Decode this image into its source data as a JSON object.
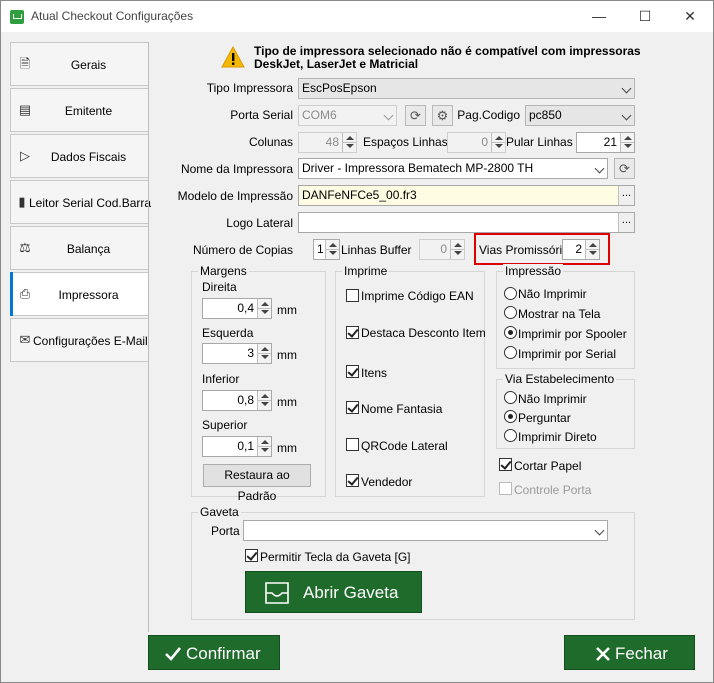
{
  "window": {
    "title": "Atual Checkout Configurações"
  },
  "sidebar": {
    "items": [
      {
        "label": "Gerais",
        "icon": "document-icon"
      },
      {
        "label": "Emitente",
        "icon": "card-icon"
      },
      {
        "label": "Dados Fiscais",
        "icon": "flag-icon"
      },
      {
        "label": "Leitor Serial Cod.Barra",
        "icon": "barcode-icon"
      },
      {
        "label": "Balança",
        "icon": "scale-icon"
      },
      {
        "label": "Impressora",
        "icon": "printer-icon"
      },
      {
        "label": "Configurações E-Mail",
        "icon": "email-icon"
      }
    ],
    "active_index": 5
  },
  "warning": {
    "line1": "Tipo de impressora selecionado não é compatível com impressoras",
    "line2": "DeskJet, LaserJet e Matricial"
  },
  "form": {
    "tipo_impressora_label": "Tipo Impressora",
    "tipo_impressora_value": "EscPosEpson",
    "porta_serial_label": "Porta Serial",
    "porta_serial_value": "COM6",
    "pag_codigo_label": "Pag.Codigo",
    "pag_codigo_value": "pc850",
    "colunas_label": "Colunas",
    "colunas_value": "48",
    "espacos_linhas_label": "Espaços Linhas",
    "espacos_linhas_value": "0",
    "pular_linhas_label": "Pular Linhas",
    "pular_linhas_value": "21",
    "nome_impressora_label": "Nome da Impressora",
    "nome_impressora_value": "Driver - Impressora Bematech MP-2800 TH",
    "modelo_impressao_label": "Modelo de Impressão",
    "modelo_impressao_value": "DANFeNFCe5_00.fr3",
    "logo_lateral_label": "Logo Lateral",
    "logo_lateral_value": "",
    "numero_copias_label": "Número de Copias",
    "numero_copias_value": "1",
    "linhas_buffer_label": "Linhas Buffer",
    "linhas_buffer_value": "0",
    "vias_promissoria_label": "Vias Promissória",
    "vias_promissoria_value": "2",
    "dots": "..."
  },
  "margens": {
    "title": "Margens",
    "unit": "mm",
    "direita_label": "Direita",
    "direita_value": "0,4",
    "esquerda_label": "Esquerda",
    "esquerda_value": "3",
    "inferior_label": "Inferior",
    "inferior_value": "0,8",
    "superior_label": "Superior",
    "superior_value": "0,1",
    "restore_label": "Restaura ao Padrão"
  },
  "imprime": {
    "title": "Imprime",
    "items": [
      {
        "label": "Imprime Código EAN",
        "checked": false
      },
      {
        "label": "Destaca Desconto Item",
        "checked": true
      },
      {
        "label": "Itens",
        "checked": true
      },
      {
        "label": "Nome Fantasia",
        "checked": true
      },
      {
        "label": "QRCode Lateral",
        "checked": false
      },
      {
        "label": "Vendedor",
        "checked": true
      }
    ]
  },
  "impressao": {
    "title": "Impressão",
    "options": [
      "Não Imprimir",
      "Mostrar na Tela",
      "Imprimir por Spooler",
      "Imprimir por Serial"
    ],
    "selected": 2
  },
  "via_estabelecimento": {
    "title": "Via Estabelecimento",
    "options": [
      "Não Imprimir",
      "Perguntar",
      "Imprimir Direto"
    ],
    "selected": 1
  },
  "cortar_papel_label": "Cortar Papel",
  "controle_porta_label": "Controle Porta",
  "gaveta": {
    "title": "Gaveta",
    "porta_label": "Porta",
    "porta_value": "",
    "permitir_label": "Permitir Tecla da Gaveta [G]",
    "abrir_label": "Abrir Gaveta"
  },
  "footer": {
    "confirm_label": "Confirmar",
    "close_label": "Fechar"
  },
  "colors": {
    "accent": "#0078d7",
    "button_green": "#1e6b2b",
    "highlight_red": "#e00000",
    "warning_yellow": "#f5b800"
  }
}
